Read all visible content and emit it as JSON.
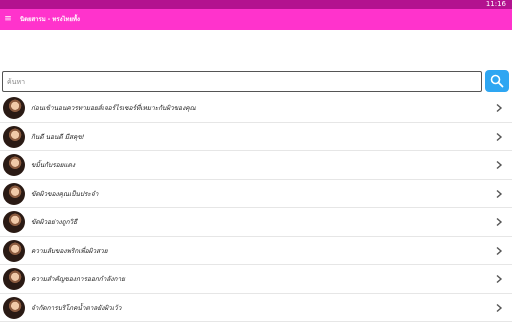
{
  "status_bar": {
    "time": "11:16"
  },
  "app_bar": {
    "menu_icon": "menu-icon",
    "title": "นิตยสารม - ทรงไทยทั้ง"
  },
  "search": {
    "placeholder": "ค้นหา",
    "value": "",
    "button_icon": "search-icon"
  },
  "list": {
    "items": [
      {
        "label": "ก่อนเข้านอนควรทามอยส์เจอร์ไรเซอร์ที่เหมาะกับผิวของคุณ"
      },
      {
        "label": "กินดี นอนดี มีสคุข!"
      },
      {
        "label": "ขมิ้นกับรอยแดง"
      },
      {
        "label": "ขัดผิวของคุณเป็นประจำ"
      },
      {
        "label": "ขัดผิวอย่างถูกวิธี"
      },
      {
        "label": "ความลับของพริกเพื่อผิวสวย"
      },
      {
        "label": "ความสำคัญของการออกกำลังกาย"
      },
      {
        "label": "จำกัดการบริโภคน้ำตาลยังผิวเว้ว"
      }
    ]
  },
  "colors": {
    "status_bar": "#b3128f",
    "app_bar": "#ff33cc",
    "search_button": "#2ea6f2"
  }
}
